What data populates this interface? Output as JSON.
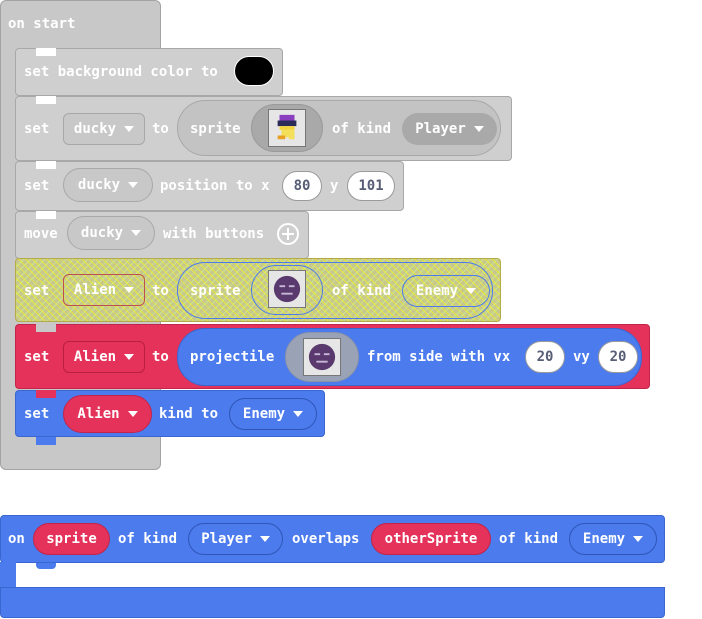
{
  "on_start": {
    "hat_label": "on start",
    "b1": {
      "set_label": "set background color to",
      "color": "#000000"
    },
    "b2": {
      "set_label": "set",
      "var": "ducky",
      "to_label": "to",
      "sprite_label": "sprite",
      "kind_label": "of kind",
      "kind": "Player"
    },
    "b3": {
      "set_label": "set",
      "var": "ducky",
      "position_label": "position to x",
      "x": "80",
      "y_label": "y",
      "y": "101"
    },
    "b4": {
      "move_label": "move",
      "var": "ducky",
      "with_label": "with buttons"
    },
    "b5": {
      "set_label": "set",
      "var": "Alien",
      "to_label": "to",
      "sprite_label": "sprite",
      "kind_label": "of kind",
      "kind": "Enemy"
    },
    "b6": {
      "set_label": "set",
      "var": "Alien",
      "to_label": "to",
      "projectile_label": "projectile",
      "from_label": "from side with vx",
      "vx": "20",
      "vy_label": "vy",
      "vy": "20"
    },
    "b7": {
      "set_label": "set",
      "var": "Alien",
      "kind_label": "kind to",
      "kind": "Enemy"
    }
  },
  "overlap_event": {
    "on_label": "on",
    "sprite_var": "sprite",
    "kind_label_1": "of kind",
    "kind_1": "Player",
    "overlaps_label": "overlaps",
    "other_var": "otherSprite",
    "kind_label_2": "of kind",
    "kind_2": "Enemy"
  },
  "icons": {
    "plus": "plus-circle-icon",
    "caret": "caret-down-icon",
    "duck": "duck-sprite-icon",
    "alien": "alien-sprite-icon"
  },
  "colors": {
    "loops_gray": "#c8c8c8",
    "sprite_red": "#e5325a",
    "sprite_blue": "#4b7bec",
    "disabled_yellow": "#c8c88e"
  }
}
